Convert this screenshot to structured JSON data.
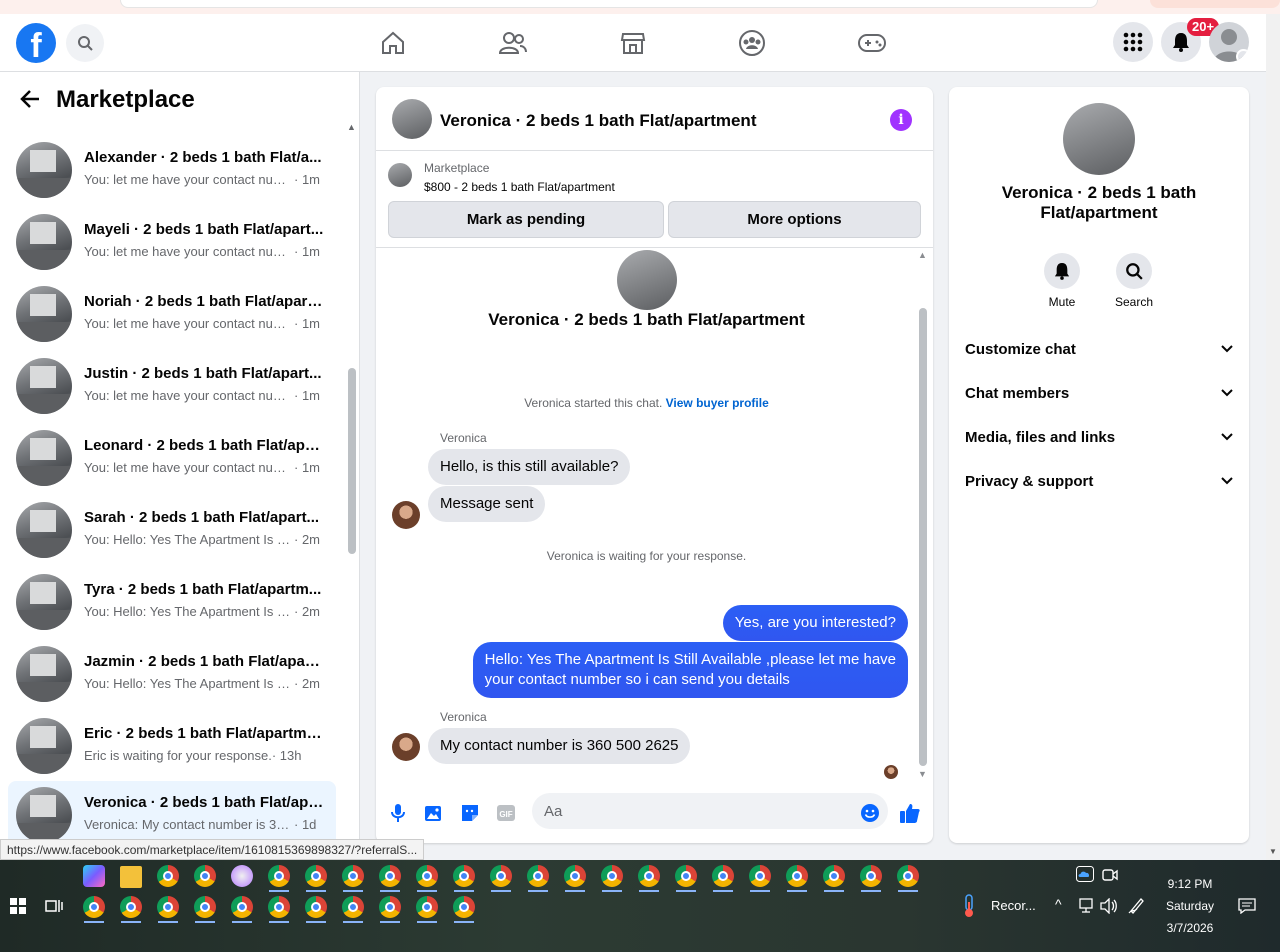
{
  "header": {
    "notif_badge": "20+"
  },
  "sidebar": {
    "title": "Marketplace",
    "conversations": [
      {
        "name": "Alexander · 2 beds 1 bath Flat/a...",
        "snippet": "You: let me have your contact num...",
        "time": " · 1m"
      },
      {
        "name": "Mayeli · 2 beds 1 bath Flat/apart...",
        "snippet": "You: let me have your contact num...",
        "time": " · 1m"
      },
      {
        "name": "Noriah · 2 beds 1 bath Flat/apart...",
        "snippet": "You: let me have your contact num...",
        "time": " · 1m"
      },
      {
        "name": "Justin · 2 beds 1 bath Flat/apart...",
        "snippet": "You: let me have your contact num...",
        "time": " · 1m"
      },
      {
        "name": "Leonard · 2 beds 1 bath Flat/apa...",
        "snippet": "You: let me have your contact num...",
        "time": " · 1m"
      },
      {
        "name": "Sarah · 2 beds 1 bath Flat/apart...",
        "snippet": "You: Hello: Yes The Apartment Is St...",
        "time": " · 2m"
      },
      {
        "name": "Tyra · 2 beds 1 bath Flat/apartm...",
        "snippet": "You: Hello: Yes The Apartment Is St...",
        "time": " · 2m"
      },
      {
        "name": "Jazmin · 2 beds 1 bath Flat/apart...",
        "snippet": "You: Hello: Yes The Apartment Is St...",
        "time": " · 2m"
      },
      {
        "name": "Eric · 2 beds 1 bath Flat/apartment",
        "snippet": "Eric is waiting for your response.",
        "time": " · 13h"
      },
      {
        "name": "Veronica · 2 beds 1 bath Flat/apa...",
        "snippet": "Veronica: My contact number is 36...",
        "time": " · 1d"
      }
    ]
  },
  "chat": {
    "title": "Veronica · 2 beds 1 bath Flat/apartment",
    "marketplace_label": "Marketplace",
    "listing": "$800 - 2 beds 1 bath Flat/apartment",
    "mark_pending": "Mark as pending",
    "more_options": "More options",
    "intro_title": "Veronica · 2 beds 1 bath Flat/apartment",
    "started_text": "Veronica started this chat.",
    "view_buyer": "View buyer profile",
    "sender_1": "Veronica",
    "msg_1": "Hello, is this still available?",
    "msg_2": "Message sent",
    "waiting": "Veronica is waiting for your response.",
    "out_1": "Yes, are you interested?",
    "out_2_line1": "Hello: Yes The Apartment Is Still Available ,please let me have",
    "out_2_line2": "your contact number so i can send you details",
    "sender_2": "Veronica",
    "msg_3": "My contact number is 360 500 2625",
    "composer_placeholder": "Aa"
  },
  "details": {
    "title": "Veronica · 2 beds 1 bath Flat/apartment",
    "mute": "Mute",
    "search": "Search",
    "rows": [
      "Customize chat",
      "Chat members",
      "Media, files and links",
      "Privacy & support"
    ]
  },
  "status_url": "https://www.facebook.com/marketplace/item/1610815369898327/?referralS...",
  "taskbar": {
    "recorder": "Recor...",
    "time": "9:12 PM",
    "day": "Saturday",
    "date": "3/7/2026"
  }
}
